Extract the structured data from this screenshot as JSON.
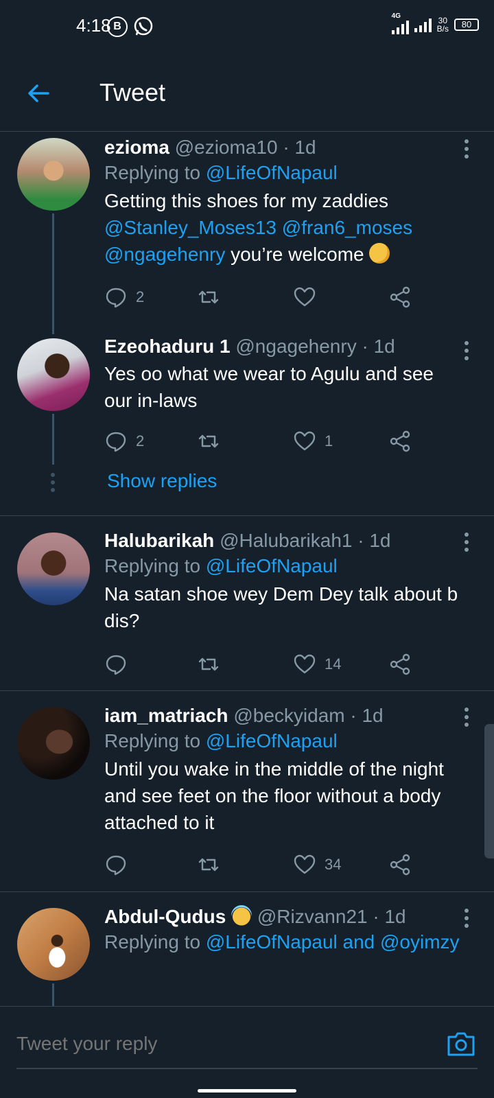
{
  "status_bar": {
    "time": "4:18",
    "app_icon_b": "B",
    "network": "4G",
    "speed_value": "30",
    "speed_unit": "B/s",
    "battery": "80"
  },
  "header": {
    "title": "Tweet"
  },
  "tweets": [
    {
      "name": "ezioma",
      "handle": "@ezioma10 · 1d",
      "reply_prefix": "Replying to ",
      "reply_to": "@LifeOfNapaul",
      "text_1": "Getting this shoes for my zaddies ",
      "mention_1": "@Stanley_Moses13",
      "mention_2": "@fran6_moses",
      "mention_3": "@ngagehenry",
      "text_2": " you’re welcome",
      "replies": "2",
      "likes": ""
    },
    {
      "name": "Ezeohaduru 1",
      "handle": "@ngagehenry · 1d",
      "text": "Yes oo what we wear to Agulu and see our in-laws",
      "replies": "2",
      "likes": "1",
      "show_replies": "Show replies"
    },
    {
      "name": "Halubarikah",
      "handle": "@Halubarikah1 · 1d",
      "reply_prefix": "Replying to ",
      "reply_to": "@LifeOfNapaul",
      "text": "Na satan shoe wey Dem Dey talk about b dis?",
      "replies": "",
      "likes": "14"
    },
    {
      "name": "iam_matriach",
      "handle": "@beckyidam · 1d",
      "reply_prefix": "Replying to ",
      "reply_to": "@LifeOfNapaul",
      "text": "Until you wake in the middle of the night and see feet on the floor without a body attached to it",
      "replies": "",
      "likes": "34"
    },
    {
      "name": "Abdul-Qudus",
      "handle": "@Rizvann21 · 1d",
      "reply_prefix": "Replying to ",
      "reply_to": "@LifeOfNapaul and @oyimzy"
    }
  ],
  "compose": {
    "placeholder": "Tweet your reply"
  },
  "icons": {
    "back": "arrow-left-icon",
    "reply": "speech-bubble-icon",
    "retweet": "retweet-icon",
    "like": "heart-icon",
    "share": "share-icon",
    "more": "more-vertical-icon",
    "camera": "camera-icon"
  },
  "colors": {
    "background": "#15202b",
    "accent": "#1da1f2",
    "secondary_text": "#8899a6",
    "divider": "#38444d"
  }
}
